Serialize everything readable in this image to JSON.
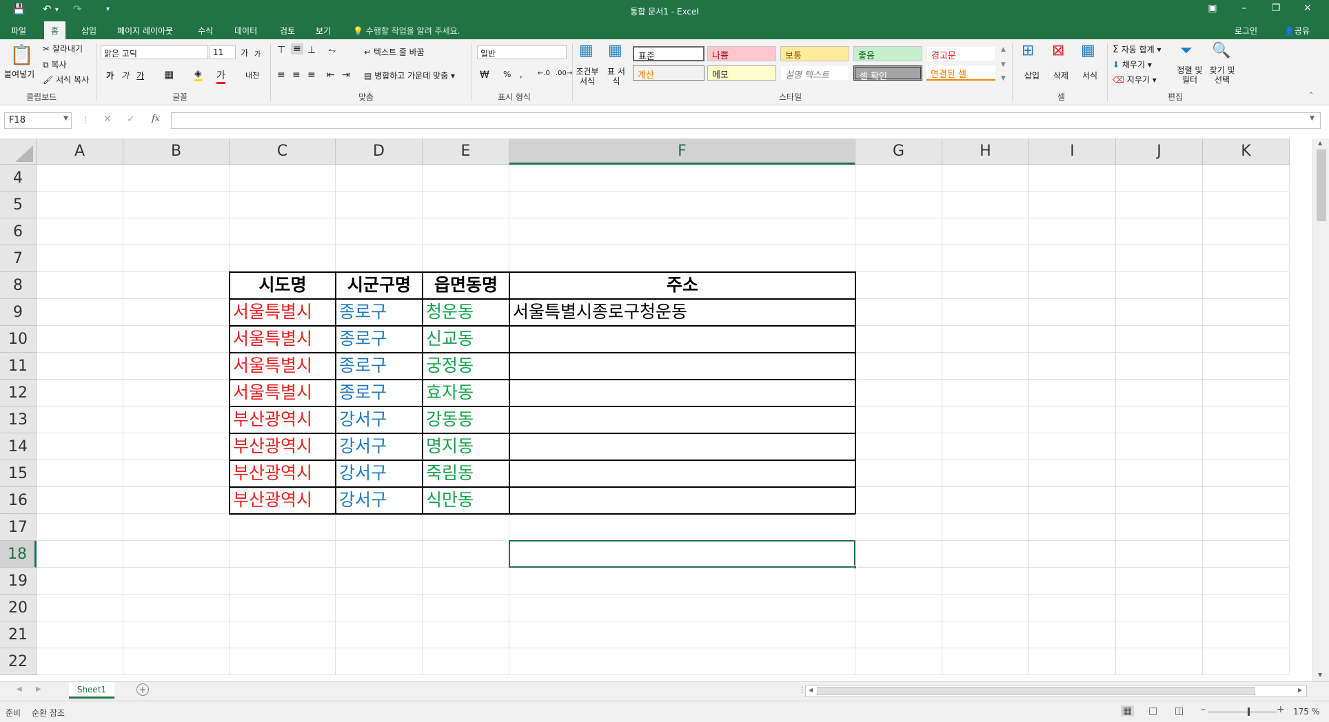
{
  "titlebar": {
    "title": "통합 문서1 - Excel",
    "quick_access": [
      "save-icon",
      "undo-icon",
      "redo-icon",
      "customize-icon"
    ]
  },
  "tabs": [
    "파일",
    "홈",
    "삽입",
    "페이지 레이아웃",
    "수식",
    "데이터",
    "검토",
    "보기"
  ],
  "tell_me": "수행할 작업을 알려 주세요.",
  "login": "로그인",
  "share": "공유",
  "ribbon": {
    "clipboard": {
      "paste": "붙여넣기",
      "cut": "잘라내기",
      "copy": "복사",
      "format_painter": "서식 복사",
      "label": "클립보드"
    },
    "font": {
      "name": "맑은 고딕",
      "size": "11",
      "label": "글꼴",
      "grow": "가",
      "shrink": "가",
      "bold": "가",
      "italic": "가",
      "underline": "가",
      "phonetic": "내천"
    },
    "alignment": {
      "wrap": "텍스트 줄 바꿈",
      "merge": "병합하고 가운데 맞춤",
      "label": "맞춤"
    },
    "number": {
      "format": "일반",
      "label": "표시 형식",
      "percent": "%",
      "comma": ","
    },
    "styles": {
      "cond_format": "조건부 서식",
      "table_format": "표 서식",
      "cells": [
        "표준",
        "나쁨",
        "보통",
        "좋음",
        "경고문",
        "계산",
        "메모",
        "설명 텍스트",
        "셀 확인",
        "연결된 셀"
      ],
      "label": "스타일"
    },
    "cells": {
      "insert": "삽입",
      "delete": "삭제",
      "format": "서식",
      "label": "셀"
    },
    "editing": {
      "autosum": "자동 합계",
      "fill": "채우기",
      "clear": "지우기",
      "sort": "정렬 및 필터",
      "find": "찾기 및 선택",
      "label": "편집"
    }
  },
  "formula_bar": {
    "name_box": "F18",
    "formula": ""
  },
  "columns": [
    "A",
    "B",
    "C",
    "D",
    "E",
    "F",
    "G",
    "H",
    "I",
    "J",
    "K"
  ],
  "rows": [
    "4",
    "5",
    "6",
    "7",
    "8",
    "9",
    "10",
    "11",
    "12",
    "13",
    "14",
    "15",
    "16",
    "17",
    "18",
    "19",
    "20",
    "21",
    "22"
  ],
  "selected": {
    "column": "F",
    "row": "18"
  },
  "table": {
    "headers": [
      "시도명",
      "시군구명",
      "읍면동명",
      "주소"
    ],
    "rows": [
      [
        "서울특별시",
        "종로구",
        "청운동",
        "서울특별시종로구청운동"
      ],
      [
        "서울특별시",
        "종로구",
        "신교동",
        ""
      ],
      [
        "서울특별시",
        "종로구",
        "궁정동",
        ""
      ],
      [
        "서울특별시",
        "종로구",
        "효자동",
        ""
      ],
      [
        "부산광역시",
        "강서구",
        "강동동",
        ""
      ],
      [
        "부산광역시",
        "강서구",
        "명지동",
        ""
      ],
      [
        "부산광역시",
        "강서구",
        "죽림동",
        ""
      ],
      [
        "부산광역시",
        "강서구",
        "식만동",
        ""
      ]
    ]
  },
  "colors": {
    "accent": "#217346",
    "sido": "#e8201f",
    "sigungu": "#1f7bc1",
    "eupmyeondong": "#18a34a"
  },
  "sheets": [
    "Sheet1"
  ],
  "status": {
    "ready": "준비",
    "circular": "순환 참조",
    "zoom": "175 %"
  }
}
